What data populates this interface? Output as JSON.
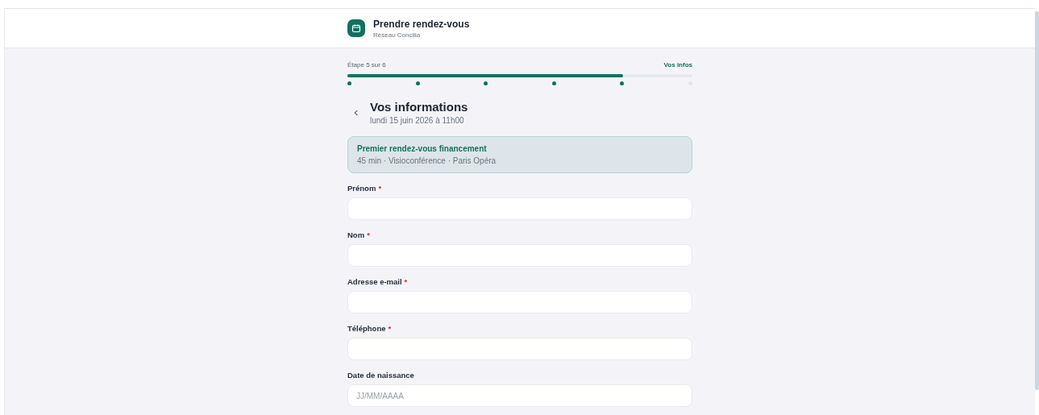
{
  "header": {
    "title": "Prendre rendez-vous",
    "subtitle": "Réseau Concilia"
  },
  "progress": {
    "step_label": "Étape 5 sur 6",
    "current_label": "Vos infos",
    "level": 0.8,
    "steps": [
      {
        "done": true
      },
      {
        "done": true
      },
      {
        "done": true
      },
      {
        "done": true
      },
      {
        "done": true
      },
      {
        "done": false
      }
    ]
  },
  "heading": {
    "title": "Vos informations",
    "date": "lundi 15 juin 2026 à 11h00"
  },
  "appointment": {
    "title": "Premier rendez-vous financement",
    "details": "45 min · Visioconférence · Paris Opéra"
  },
  "fields": [
    {
      "label": "Prénom",
      "required_mark": "*"
    },
    {
      "label": "Nom",
      "required_mark": "*"
    },
    {
      "label": "Adresse e-mail",
      "required_mark": "*"
    },
    {
      "label": "Téléphone",
      "required_mark": "*"
    },
    {
      "label": "Date de naissance",
      "placeholder": "JJ/MM/AAAA"
    }
  ]
}
